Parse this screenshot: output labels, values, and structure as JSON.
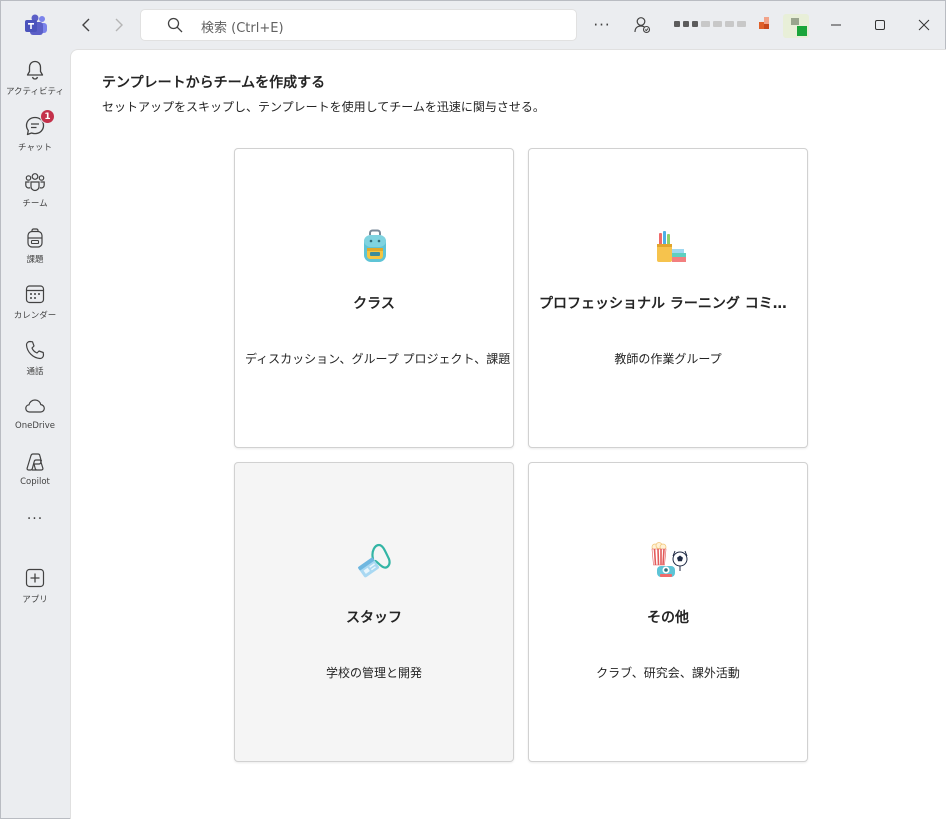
{
  "titlebar": {
    "search_placeholder": "検索 (Ctrl+E)",
    "more_label": "···"
  },
  "rail": {
    "items": [
      {
        "label": "アクティビティ",
        "icon": "bell-icon"
      },
      {
        "label": "チャット",
        "icon": "chat-icon",
        "badge": "1"
      },
      {
        "label": "チーム",
        "icon": "teams-icon"
      },
      {
        "label": "課題",
        "icon": "backpack-icon"
      },
      {
        "label": "カレンダー",
        "icon": "calendar-icon"
      },
      {
        "label": "通話",
        "icon": "phone-icon"
      },
      {
        "label": "OneDrive",
        "icon": "cloud-icon"
      },
      {
        "label": "Copilot",
        "icon": "copilot-icon"
      },
      {
        "label": "アプリ",
        "icon": "add-app-icon"
      }
    ],
    "more": "···"
  },
  "main": {
    "title": "テンプレートからチームを作成する",
    "subtitle": "セットアップをスキップし、テンプレートを使用してチームを迅速に関与させる。",
    "cards": [
      {
        "title": "クラス",
        "desc": "ディスカッション、グループ プロジェクト、課題",
        "icon": "backpack-icon"
      },
      {
        "title": "プロフェッショナル ラーニング コミュニテ…",
        "desc": "教師の作業グループ",
        "icon": "pencil-cup-icon"
      },
      {
        "title": "スタッフ",
        "desc": "学校の管理と開発",
        "icon": "lanyard-badge-icon"
      },
      {
        "title": "その他",
        "desc": "クラブ、研究会、課外活動",
        "icon": "popcorn-soccer-icon"
      }
    ]
  },
  "colors": {
    "accent": "#5b5fc7",
    "badge": "#c4314b",
    "teal": "#33b5a5"
  }
}
